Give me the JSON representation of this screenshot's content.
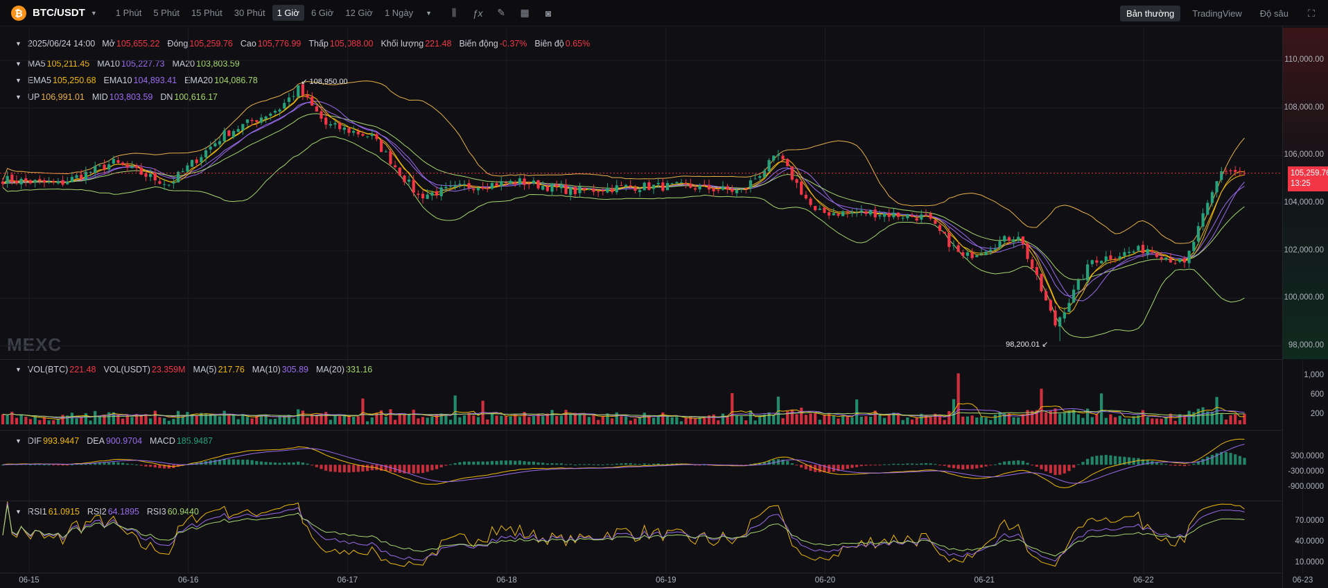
{
  "toolbar": {
    "logo_glyph": "₿",
    "symbol": "BTC/USDT",
    "timeframes": [
      "1 Phút",
      "5 Phút",
      "15 Phút",
      "30 Phút",
      "1 Giờ",
      "6 Giờ",
      "12 Giờ",
      "1 Ngày"
    ],
    "active_timeframe_index": 4,
    "icons": [
      "candle-type-icon",
      "indicator-fx-icon",
      "draw-pencil-icon",
      "layout-grid-icon",
      "camera-icon"
    ],
    "views": [
      "Bản thường",
      "TradingView",
      "Độ sâu"
    ],
    "active_view_index": 0,
    "fullscreen_icon": "fullscreen-icon"
  },
  "ohlc_legend": {
    "date": "2025/06/24 14:00",
    "open_label": "Mở",
    "open": "105,655.22",
    "close_label": "Đóng",
    "close": "105,259.76",
    "high_label": "Cao",
    "high": "105,776.99",
    "low_label": "Thấp",
    "low": "105,088.00",
    "volume_label": "Khối lượng",
    "volume": "221.48",
    "change_label": "Biến động",
    "change": "-0.37%",
    "amplitude_label": "Biên độ",
    "amplitude": "0.65%"
  },
  "ma_legend": {
    "ma5_label": "MA5",
    "ma5": "105,211.45",
    "ma10_label": "MA10",
    "ma10": "105,227.73",
    "ma20_label": "MA20",
    "ma20": "103,803.59"
  },
  "ema_legend": {
    "ema5_label": "EMA5",
    "ema5": "105,250.68",
    "ema10_label": "EMA10",
    "ema10": "104,893.41",
    "ema20_label": "EMA20",
    "ema20": "104,086.78"
  },
  "boll_legend": {
    "up_label": "UP",
    "up": "106,991.01",
    "mid_label": "MID",
    "mid": "103,803.59",
    "dn_label": "DN",
    "dn": "100,616.17"
  },
  "vol_legend": {
    "vol_btc_label": "VOL(BTC)",
    "vol_btc": "221.48",
    "vol_usdt_label": "VOL(USDT)",
    "vol_usdt": "23.359M",
    "ma5_label": "MA(5)",
    "ma5": "217.76",
    "ma10_label": "MA(10)",
    "ma10": "305.89",
    "ma20_label": "MA(20)",
    "ma20": "331.16"
  },
  "macd_legend": {
    "dif_label": "DIF",
    "dif": "993.9447",
    "dea_label": "DEA",
    "dea": "900.9704",
    "macd_label": "MACD",
    "macd": "185.9487"
  },
  "rsi_legend": {
    "rsi1_label": "RSI1",
    "rsi1": "61.0915",
    "rsi2_label": "RSI2",
    "rsi2": "64.1895",
    "rsi3_label": "RSI3",
    "rsi3": "60.9440"
  },
  "watermark": "MEXC",
  "last_price": {
    "value": "105,259.76",
    "countdown": "13:25"
  },
  "high_marker": "108,950.00",
  "low_marker": "98,200.01",
  "colors": {
    "up": "#26a17b",
    "down": "#f23645",
    "ma5": "#f0b90b",
    "ma10": "#9b6cf0",
    "ma20": "#a6d86e",
    "boll_up": "#e8b14a",
    "boll_mid": "#9b6cf0",
    "boll_dn": "#a6d86e",
    "dif": "#f0b90b",
    "dea": "#9b6cf0",
    "rsi1": "#f0b90b",
    "rsi2": "#9b6cf0",
    "rsi3": "#a6d86e"
  },
  "chart_data": [
    {
      "type": "candlestick",
      "title": "",
      "y_ticks": [
        "110,000.00",
        "108,000.00",
        "106,000.00",
        "104,000.00",
        "102,000.00",
        "100,000.00",
        "98,000.00"
      ],
      "ylim": [
        97500,
        110500
      ],
      "x_ticks": [
        "06-15",
        "06-16",
        "06-17",
        "06-18",
        "06-19",
        "06-20",
        "06-21",
        "06-22",
        "06-23"
      ],
      "anchors": [
        {
          "i": 0,
          "p": 105000
        },
        {
          "i": 12,
          "p": 104800
        },
        {
          "i": 24,
          "p": 105700
        },
        {
          "i": 36,
          "p": 104800
        },
        {
          "i": 48,
          "p": 106900
        },
        {
          "i": 60,
          "p": 108000
        },
        {
          "i": 64,
          "p": 108800
        },
        {
          "i": 70,
          "p": 107300
        },
        {
          "i": 80,
          "p": 106800
        },
        {
          "i": 90,
          "p": 104300
        },
        {
          "i": 100,
          "p": 104700
        },
        {
          "i": 112,
          "p": 104900
        },
        {
          "i": 124,
          "p": 104500
        },
        {
          "i": 136,
          "p": 104700
        },
        {
          "i": 148,
          "p": 104700
        },
        {
          "i": 160,
          "p": 104500
        },
        {
          "i": 168,
          "p": 106000
        },
        {
          "i": 176,
          "p": 103600
        },
        {
          "i": 188,
          "p": 103600
        },
        {
          "i": 200,
          "p": 103400
        },
        {
          "i": 208,
          "p": 101700
        },
        {
          "i": 220,
          "p": 102700
        },
        {
          "i": 228,
          "p": 98900
        },
        {
          "i": 236,
          "p": 101600
        },
        {
          "i": 248,
          "p": 102100
        },
        {
          "i": 256,
          "p": 101400
        },
        {
          "i": 264,
          "p": 105400
        },
        {
          "i": 269,
          "p": 105260
        }
      ]
    },
    {
      "type": "bar",
      "title": "",
      "series_name": "VOL(BTC)",
      "y_ticks": [
        "1,000",
        "600",
        "200"
      ],
      "ylim": [
        0,
        1100
      ]
    },
    {
      "type": "bar+line",
      "title": "",
      "series": [
        "DIF",
        "DEA",
        "MACD"
      ],
      "y_ticks": [
        "300.0000",
        "-300.0000",
        "-900.0000"
      ],
      "ylim": [
        -1250,
        1100
      ]
    },
    {
      "type": "line",
      "title": "",
      "series": [
        "RSI1",
        "RSI2",
        "RSI3"
      ],
      "y_ticks": [
        "70.0000",
        "40.0000",
        "10.0000"
      ],
      "ylim": [
        0,
        90
      ]
    }
  ]
}
